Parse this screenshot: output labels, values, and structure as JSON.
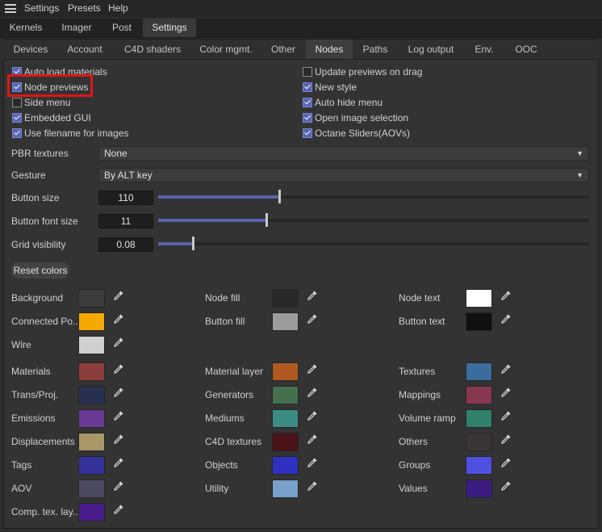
{
  "menubar": {
    "items": [
      "Settings",
      "Presets",
      "Help"
    ]
  },
  "kernel_tabs": [
    "Kernels",
    "Imager",
    "Post",
    "Settings"
  ],
  "settings_tabs": [
    "Devices",
    "Account",
    "C4D shaders",
    "Color mgmt.",
    "Other",
    "Nodes",
    "Paths",
    "Log output",
    "Env.",
    "OOC"
  ],
  "checkboxes_left": [
    {
      "label": "Auto load materials",
      "checked": true
    },
    {
      "label": "Node previews",
      "checked": true
    },
    {
      "label": "Side menu",
      "checked": false
    },
    {
      "label": "Embedded GUI",
      "checked": true
    },
    {
      "label": "Use filename for images",
      "checked": true
    }
  ],
  "checkboxes_right": [
    {
      "label": "Update previews on drag",
      "checked": false
    },
    {
      "label": "New style",
      "checked": true
    },
    {
      "label": "Auto hide menu",
      "checked": true
    },
    {
      "label": "Open image selection",
      "checked": true
    },
    {
      "label": "Octane Sliders(AOVs)",
      "checked": true
    }
  ],
  "pbr": {
    "label": "PBR textures",
    "value": "None"
  },
  "gesture": {
    "label": "Gesture",
    "value": "By ALT key"
  },
  "sliders": [
    {
      "label": "Button size",
      "value": "110",
      "fraction": 0.28
    },
    {
      "label": "Button font size",
      "value": "11",
      "fraction": 0.25
    },
    {
      "label": "Grid visibility",
      "value": "0.08",
      "fraction": 0.08
    }
  ],
  "reset_label": "Reset colors",
  "colors": {
    "col1": [
      {
        "label": "Background",
        "color": "#3c3c3c"
      },
      {
        "label": "Connected Po...",
        "color": "#f5a800"
      },
      {
        "label": "Wire",
        "color": "#d0d0d0"
      },
      {
        "label": "Materials",
        "color": "#8c3e3e"
      },
      {
        "label": "Trans/Proj.",
        "color": "#283050"
      },
      {
        "label": "Emissions",
        "color": "#6a3a96"
      },
      {
        "label": "Displacements",
        "color": "#a89868"
      },
      {
        "label": "Tags",
        "color": "#32329a"
      },
      {
        "label": "AOV",
        "color": "#4a4a60"
      },
      {
        "label": "Comp. tex. lay...",
        "color": "#4a1c8c"
      }
    ],
    "col2": [
      {
        "label": "Node fill",
        "color": "#282828"
      },
      {
        "label": "Button fill",
        "color": "#9c9c9c"
      },
      {
        "label": "Material layer",
        "color": "#b05a20"
      },
      {
        "label": "Generators",
        "color": "#44704e"
      },
      {
        "label": "Mediums",
        "color": "#3c8c84"
      },
      {
        "label": "C4D textures",
        "color": "#4a1418"
      },
      {
        "label": "Objects",
        "color": "#3030c0"
      },
      {
        "label": "Utility",
        "color": "#78a0cc"
      }
    ],
    "col3": [
      {
        "label": "Node text",
        "color": "#ffffff"
      },
      {
        "label": "Button text",
        "color": "#101010"
      },
      {
        "label": "Textures",
        "color": "#3a6c9e"
      },
      {
        "label": "Mappings",
        "color": "#88384e"
      },
      {
        "label": "Volume ramp",
        "color": "#30806c"
      },
      {
        "label": "Others",
        "color": "#3a3434"
      },
      {
        "label": "Groups",
        "color": "#5050e0"
      },
      {
        "label": "Values",
        "color": "#3a1c80"
      }
    ]
  },
  "icons": {
    "picker": "eyedropper-icon",
    "menu": "hamburger-icon",
    "dropdown": "dropdown-arrow-icon"
  }
}
